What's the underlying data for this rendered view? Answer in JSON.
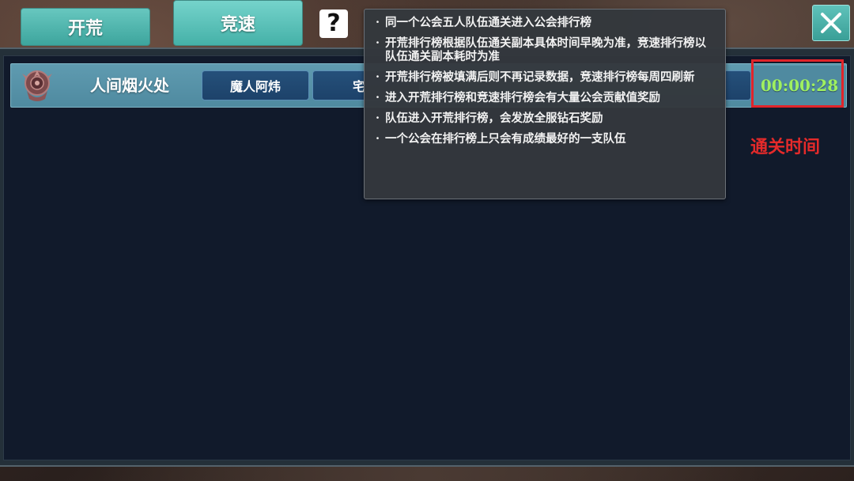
{
  "tabs": {
    "kaihuang_label": "开荒",
    "jingsu_label": "竞速"
  },
  "help": {
    "icon": "question-icon",
    "glyph": "?"
  },
  "close": {
    "icon": "close-icon"
  },
  "tooltip": {
    "bullet": "·",
    "lines": [
      "同一个公会五人队伍通关进入公会排行榜",
      "开荒排行榜根据队伍通关副本具体时间早晚为准，竞速排行榜以队伍通关副本耗时为准",
      "开荒排行榜被填满后则不再记录数据，竞速排行榜每周四刷新",
      "进入开荒排行榜和竞速排行榜会有大量公会贡献值奖励",
      "队伍进入开荒排行榜，会发放全服钻石奖励",
      "一个公会在排行榜上只会有成绩最好的一支队伍"
    ]
  },
  "ranking": {
    "rows": [
      {
        "guild_name": "人间烟火处",
        "emblem": "guild-emblem-icon",
        "members": [
          "魔人阿炜",
          "宅"
        ],
        "clear_time": "00:00:28"
      }
    ]
  },
  "annotation": {
    "label": "通关时间",
    "color": "#e1242a"
  },
  "colors": {
    "tab_accent": "#4fb8b0",
    "time_text": "#9ff060",
    "row_bg": "#5890a6"
  }
}
